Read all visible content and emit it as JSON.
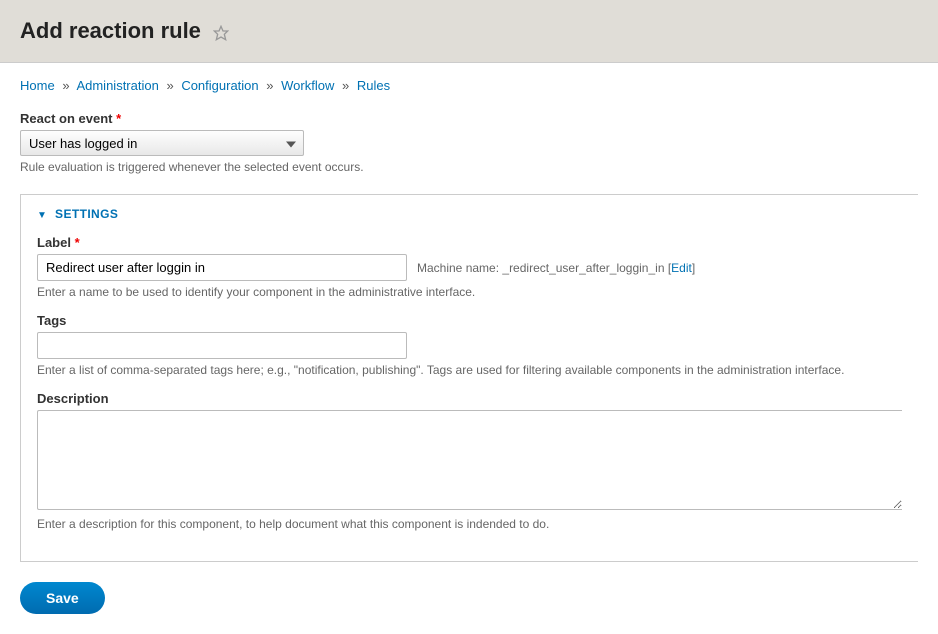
{
  "header": {
    "title": "Add reaction rule"
  },
  "breadcrumb": {
    "items": [
      "Home",
      "Administration",
      "Configuration",
      "Workflow",
      "Rules"
    ],
    "separator": "»"
  },
  "event": {
    "label": "React on event",
    "required_marker": "*",
    "selected": "User has logged in",
    "help": "Rule evaluation is triggered whenever the selected event occurs."
  },
  "settings": {
    "legend": "SETTINGS",
    "label_field": {
      "label": "Label",
      "required_marker": "*",
      "value": "Redirect user after loggin in",
      "machine_prefix": "Machine name:",
      "machine_name": "_redirect_user_after_loggin_in",
      "edit_text": "Edit",
      "help": "Enter a name to be used to identify your component in the administrative interface."
    },
    "tags_field": {
      "label": "Tags",
      "value": "",
      "help": "Enter a list of comma-separated tags here; e.g., \"notification, publishing\". Tags are used for filtering available components in the administration interface."
    },
    "description_field": {
      "label": "Description",
      "value": "",
      "help": "Enter a description for this component, to help document what this component is indended to do."
    }
  },
  "actions": {
    "save": "Save"
  }
}
